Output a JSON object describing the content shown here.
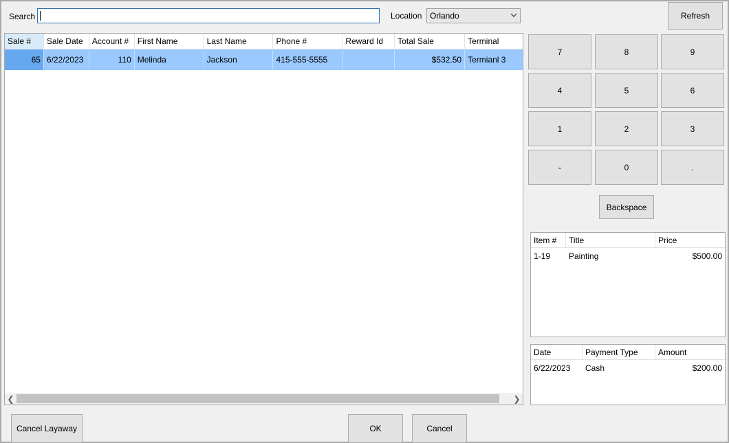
{
  "search": {
    "label": "Search",
    "value": ""
  },
  "location": {
    "label": "Location",
    "selected": "Orlando"
  },
  "refresh_label": "Refresh",
  "sales_table": {
    "columns": [
      "Sale #",
      "Sale Date",
      "Account #",
      "First Name",
      "Last Name",
      "Phone #",
      "Reward Id",
      "Total Sale",
      "Terminal"
    ],
    "rows": [
      {
        "sale_no": "65",
        "sale_date": "6/22/2023",
        "account_no": "110",
        "first_name": "Melinda",
        "last_name": "Jackson",
        "phone": "415-555-5555",
        "reward_id": "",
        "total_sale": "$532.50",
        "terminal": "Termianl 3"
      }
    ]
  },
  "keypad": [
    "7",
    "8",
    "9",
    "4",
    "5",
    "6",
    "1",
    "2",
    "3",
    "-",
    "0",
    "."
  ],
  "backspace_label": "Backspace",
  "items_table": {
    "columns": [
      "Item #",
      "Title",
      "Price"
    ],
    "rows": [
      {
        "item_no": "1-19",
        "title": "Painting",
        "price": "$500.00"
      }
    ]
  },
  "payments_table": {
    "columns": [
      "Date",
      "Payment Type",
      "Amount"
    ],
    "rows": [
      {
        "date": "6/22/2023",
        "type": "Cash",
        "amount": "$200.00"
      }
    ]
  },
  "footer": {
    "cancel_layaway": "Cancel Layaway",
    "ok": "OK",
    "cancel": "Cancel"
  },
  "colors": {
    "selection": "#99c9ff",
    "selection_active": "#66a8ef",
    "header_selected": "#d9ebf9",
    "window_bg": "#f0f0f0"
  }
}
